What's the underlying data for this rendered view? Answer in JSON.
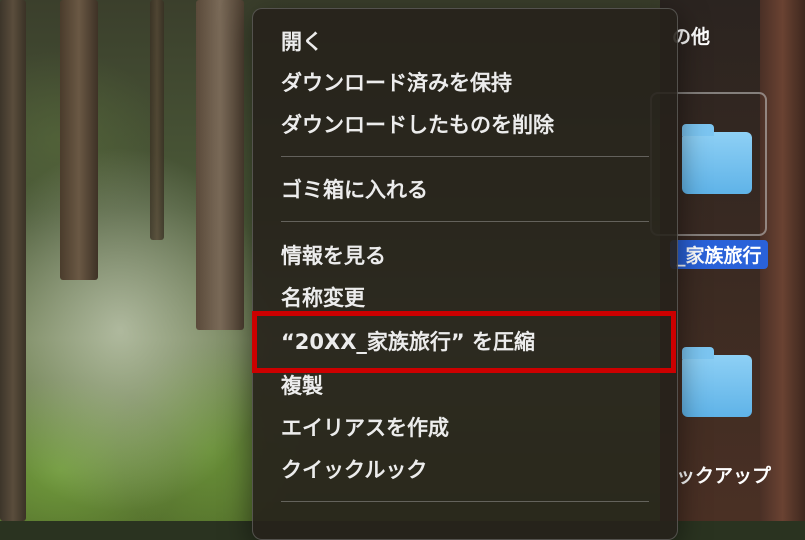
{
  "context_menu": {
    "items": [
      {
        "label": "開く"
      },
      {
        "label": "ダウンロード済みを保持"
      },
      {
        "label": "ダウンロードしたものを削除"
      },
      {
        "label": "ゴミ箱に入れる"
      },
      {
        "label": "情報を見る"
      },
      {
        "label": "名称変更"
      },
      {
        "label": "“20XX_家族旅行” を圧縮"
      },
      {
        "label": "複製"
      },
      {
        "label": "エイリアスを作成"
      },
      {
        "label": "クイックルック"
      }
    ]
  },
  "finder": {
    "section_label_fragment": "の他",
    "selected_folder_name_fragment": "_家族旅行",
    "other_folder_name_fragment": "ックアップ"
  },
  "highlight": {
    "target": "“20XX_家族旅行” を圧縮",
    "color": "#cc0000"
  },
  "colors": {
    "selection_blue": "#2a62d9",
    "folder_blue": "#6fbcec",
    "menu_background": "#26211b"
  }
}
